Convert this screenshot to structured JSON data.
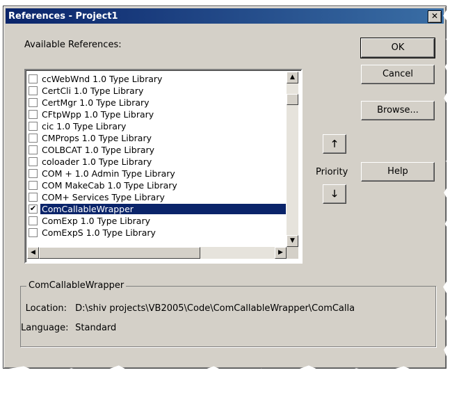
{
  "window": {
    "title": "References - Project1",
    "close_glyph": "✕"
  },
  "available_label": "Available References:",
  "references": [
    {
      "label": "ccWebWnd 1.0 Type Library",
      "checked": false,
      "selected": false
    },
    {
      "label": "CertCli 1.0 Type Library",
      "checked": false,
      "selected": false
    },
    {
      "label": "CertMgr 1.0 Type Library",
      "checked": false,
      "selected": false
    },
    {
      "label": "CFtpWpp 1.0 Type Library",
      "checked": false,
      "selected": false
    },
    {
      "label": "cic 1.0 Type Library",
      "checked": false,
      "selected": false
    },
    {
      "label": "CMProps 1.0 Type Library",
      "checked": false,
      "selected": false
    },
    {
      "label": "COLBCAT 1.0 Type Library",
      "checked": false,
      "selected": false
    },
    {
      "label": "coloader 1.0 Type Library",
      "checked": false,
      "selected": false
    },
    {
      "label": "COM + 1.0 Admin Type Library",
      "checked": false,
      "selected": false
    },
    {
      "label": "COM MakeCab 1.0 Type Library",
      "checked": false,
      "selected": false
    },
    {
      "label": "COM+ Services Type Library",
      "checked": false,
      "selected": false
    },
    {
      "label": "ComCallableWrapper",
      "checked": true,
      "selected": true
    },
    {
      "label": "ComExp 1.0 Type Library",
      "checked": false,
      "selected": false
    },
    {
      "label": "ComExpS 1.0 Type Library",
      "checked": false,
      "selected": false
    }
  ],
  "buttons": {
    "ok": "OK",
    "cancel": "Cancel",
    "browse": "Browse...",
    "help": "Help"
  },
  "priority": {
    "label": "Priority",
    "up_glyph": "🡑",
    "down_glyph": "🡓"
  },
  "details": {
    "title": "ComCallableWrapper",
    "location_label": "Location:",
    "location_value": "D:\\shiv projects\\VB2005\\Code\\ComCallableWrapper\\ComCalla",
    "language_label": "Language:",
    "language_value": "Standard"
  },
  "colors": {
    "titlebar": "#0a246a",
    "face": "#d4d0c8",
    "selection": "#0a246a"
  },
  "icons": {
    "scroll_up": "▲",
    "scroll_down": "▼",
    "scroll_left": "◀",
    "scroll_right": "▶",
    "check": "✔"
  }
}
